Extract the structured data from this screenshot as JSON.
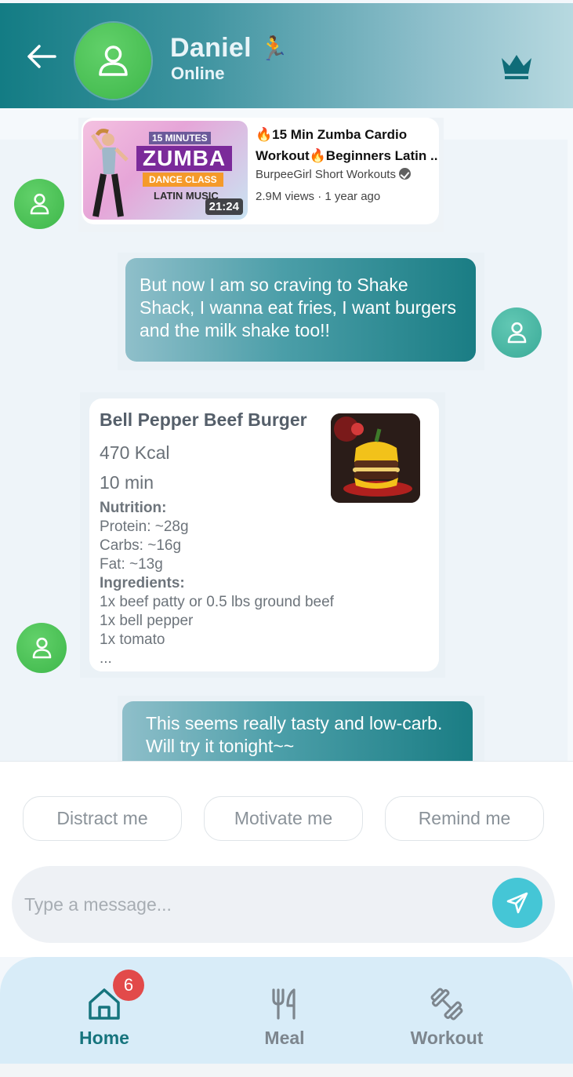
{
  "header": {
    "back_icon": "arrow-left-icon",
    "contact_name": "Daniel",
    "name_emoji": "🏃",
    "status": "Online",
    "crown_icon": "crown-icon"
  },
  "messages": {
    "video": {
      "thumb_line1": "15 MINUTES",
      "thumb_line2": "ZUMBA",
      "thumb_line3": "DANCE CLASS",
      "thumb_line4": "LATIN MUSIC",
      "duration": "21:24",
      "title_line1": "🔥15 Min Zumba Cardio",
      "title_line2": "Workout🔥Beginners Latin ..",
      "channel": "BurpeeGirl Short Workouts",
      "meta": "2.9M views · 1 year ago"
    },
    "user_message_1": "But now I am so craving to Shake Shack, I wanna eat fries, I want burgers and the milk shake too!!",
    "recipe": {
      "title": "Bell Pepper Beef Burger",
      "kcal": "470 Kcal",
      "time": "10 min",
      "nutrition_header": "Nutrition:",
      "protein": "Protein: ~28g",
      "carbs": "Carbs: ~16g",
      "fat": "Fat: ~13g",
      "ingredients_header": "Ingredients:",
      "ingredient_1": "1x beef patty or 0.5 lbs ground beef",
      "ingredient_2": "1x bell pepper",
      "ingredient_3": "1x tomato",
      "more": "..."
    },
    "user_message_2": "This seems really tasty and low-carb. Will try it tonight~~"
  },
  "quick_replies": [
    "Distract me",
    "Motivate me",
    "Remind me"
  ],
  "composer": {
    "placeholder": "Type a message...",
    "send_icon": "send-icon"
  },
  "nav": {
    "home_label": "Home",
    "home_badge": "6",
    "meal_label": "Meal",
    "workout_label": "Workout"
  },
  "colors": {
    "accent_teal": "#137c84",
    "active_nav": "#16747d",
    "inactive_nav": "#7d868e",
    "badge": "#e24a4a",
    "send_button": "#45c6d6",
    "avatar_green": "#4cc257"
  }
}
